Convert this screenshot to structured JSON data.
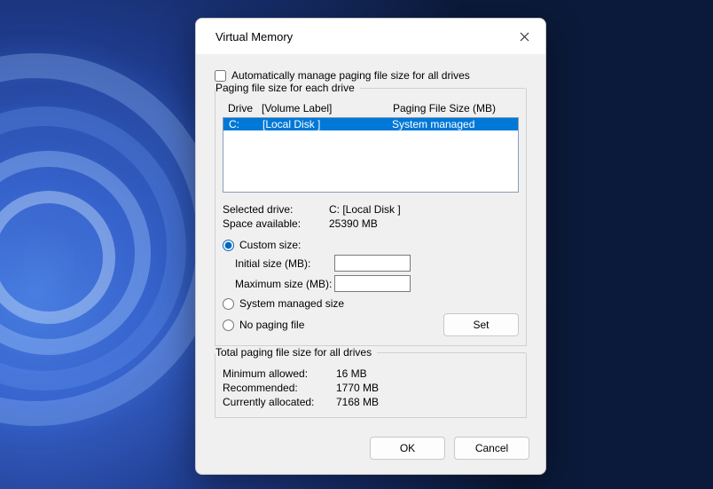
{
  "titlebar": {
    "title": "Virtual Memory"
  },
  "auto_manage": {
    "checked": false,
    "label": "Automatically manage paging file size for all drives"
  },
  "drive_group": {
    "legend": "Paging file size for each drive",
    "header": {
      "drive": "Drive",
      "volume": "[Volume Label]",
      "paging": "Paging File Size (MB)"
    },
    "rows": [
      {
        "drive": "C:",
        "volume": "[Local Disk ]",
        "paging": "System managed",
        "selected": true
      }
    ]
  },
  "selected": {
    "drive_label": "Selected drive:",
    "drive_value": "C:  [Local Disk ]",
    "space_label": "Space available:",
    "space_value": "25390 MB"
  },
  "size_mode": {
    "custom": {
      "label": "Custom size:",
      "checked": true
    },
    "initial": {
      "label": "Initial size (MB):",
      "value": ""
    },
    "maximum": {
      "label": "Maximum size (MB):",
      "value": ""
    },
    "system_managed": {
      "label": "System managed size",
      "checked": false
    },
    "no_paging": {
      "label": "No paging file",
      "checked": false
    },
    "set_button": "Set"
  },
  "totals": {
    "legend": "Total paging file size for all drives",
    "min_label": "Minimum allowed:",
    "min_value": "16 MB",
    "rec_label": "Recommended:",
    "rec_value": "1770 MB",
    "cur_label": "Currently allocated:",
    "cur_value": "7168 MB"
  },
  "footer": {
    "ok": "OK",
    "cancel": "Cancel"
  }
}
